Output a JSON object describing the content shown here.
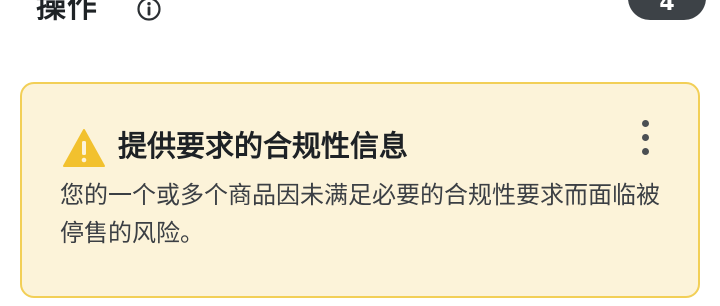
{
  "header": {
    "title": "操作",
    "count": "4"
  },
  "alert": {
    "title": "提供要求的合规性信息",
    "body": "您的一个或多个商品因未满足必要的合规性要求而面临被停售的风险。"
  },
  "colors": {
    "card_background": "#fcf3d9",
    "card_border": "#f2cf57",
    "warning": "#f2c12e",
    "badge": "#3d4247"
  },
  "icons": {
    "info": "info-icon",
    "warning": "warning-icon",
    "menu": "more-vertical-icon"
  }
}
